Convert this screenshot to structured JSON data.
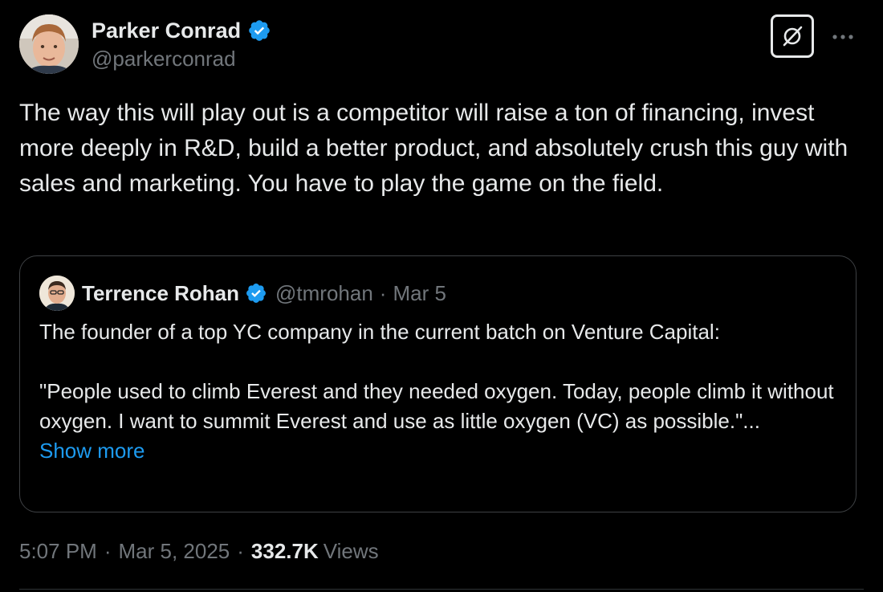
{
  "author": {
    "name": "Parker Conrad",
    "handle": "@parkerconrad",
    "verified": true
  },
  "tweet": {
    "text": "The way this will play out is a competitor will raise a ton of financing, invest more deeply in R&D, build a better product, and absolutely crush this guy with sales and marketing. You have to play the game on the field."
  },
  "quoted_tweet": {
    "author_name": "Terrence Rohan",
    "handle": "@tmrohan",
    "separator": "·",
    "date": "Mar 5",
    "verified": true,
    "paragraph_1": "The founder of a top YC company in the current batch on Venture Capital:",
    "paragraph_2": "\"People used to climb Everest and they needed oxygen.  Today, people climb it without oxygen.  I want to summit Everest and use as little oxygen (VC) as possible.\"...",
    "show_more_label": "Show more"
  },
  "meta": {
    "time": "5:07 PM",
    "separator": "·",
    "date": "Mar 5, 2025",
    "views_count": "332.7K",
    "views_label": "Views"
  },
  "icons": {
    "verified_badge": "verified-badge-icon",
    "grok": "grok-icon",
    "more": "more-horizontal-icon"
  },
  "colors": {
    "background": "#000000",
    "text_primary": "#e7e9ea",
    "text_secondary": "#71767b",
    "link_blue": "#1d9bf0",
    "verified_blue": "#1d9bf0",
    "border": "#3e4144"
  }
}
